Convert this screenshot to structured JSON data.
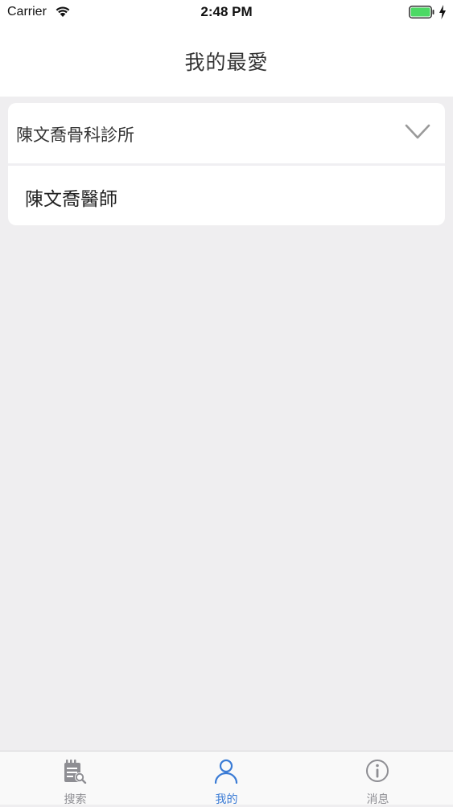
{
  "status_bar": {
    "carrier": "Carrier",
    "time": "2:48 PM"
  },
  "nav": {
    "title": "我的最愛"
  },
  "favorites": {
    "group": {
      "title": "陳文喬骨科診所",
      "items": [
        {
          "label": "陳文喬醫師"
        }
      ]
    }
  },
  "tab_bar": {
    "tabs": [
      {
        "label": "搜索",
        "icon": "search-notes-icon",
        "active": false
      },
      {
        "label": "我的",
        "icon": "person-icon",
        "active": true
      },
      {
        "label": "消息",
        "icon": "info-icon",
        "active": false
      }
    ]
  },
  "colors": {
    "accent": "#3a7bd5",
    "inactive": "#8e8e93",
    "background": "#efeef0",
    "battery_green": "#4cd964"
  }
}
